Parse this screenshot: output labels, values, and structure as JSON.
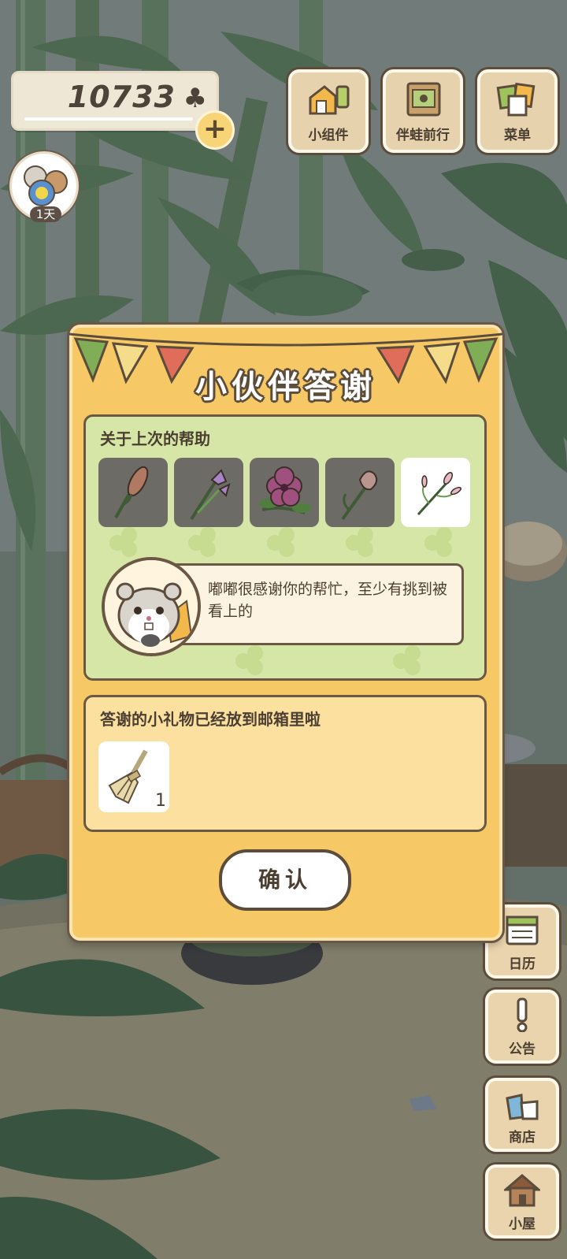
{
  "currency": {
    "clovers": "10733",
    "clover_symbol": "♣",
    "add_label": "+"
  },
  "top_menu": [
    {
      "label": "小组件",
      "icon": "widget-icon"
    },
    {
      "label": "伴蛙前行",
      "icon": "journey-book-icon"
    },
    {
      "label": "菜单",
      "icon": "menu-cards-icon"
    }
  ],
  "friend": {
    "days": "1天",
    "icon": "frog-friend-avatar"
  },
  "side_menu": [
    {
      "label": "日历",
      "icon": "calendar-icon"
    },
    {
      "label": "公告",
      "icon": "notice-exclamation-icon"
    },
    {
      "label": "商店",
      "icon": "shop-bags-icon"
    },
    {
      "label": "小屋",
      "icon": "house-icon"
    }
  ],
  "dialog": {
    "title": "小伙伴答谢",
    "help_section_title": "关于上次的帮助",
    "flowers": [
      "cattail-flower",
      "iris-flower",
      "hibiscus-flower",
      "tulip-flower",
      "white-sprig-flower"
    ],
    "selected_flower_index": 4,
    "message": "嘟嘟很感谢你的帮忙，至少有挑到被看上的",
    "gift_section_title": "答谢的小礼物已经放到邮箱里啦",
    "gift": {
      "icon": "straw-broom-icon",
      "count": "1"
    },
    "confirm_label": "确认"
  },
  "colors": {
    "dialog_bg": "#f6c866",
    "help_panel_bg": "#d6e6a6",
    "gift_panel_bg": "#fbe0a0",
    "outline": "#5b4c3b"
  }
}
